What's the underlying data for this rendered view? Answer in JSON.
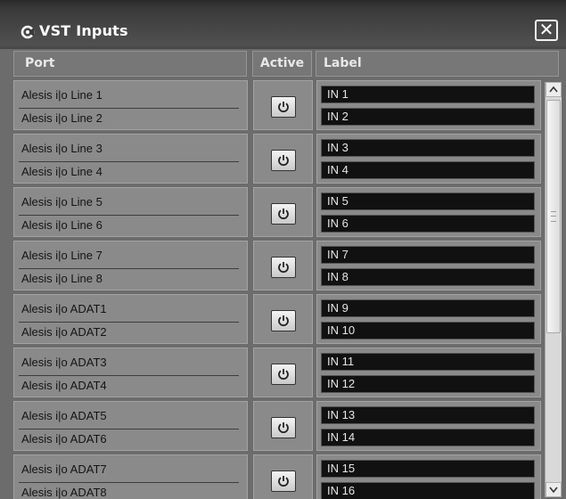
{
  "window": {
    "title": "VST Inputs",
    "close_glyph": "✕",
    "icon": "power-cycle-icon"
  },
  "columns": {
    "port": "Port",
    "active": "Active",
    "label": "Label"
  },
  "rows": [
    {
      "ports": [
        "Alesis i|o Line 1",
        "Alesis i|o Line 2"
      ],
      "labels": [
        "IN 1",
        "IN 2"
      ]
    },
    {
      "ports": [
        "Alesis i|o Line 3",
        "Alesis i|o Line 4"
      ],
      "labels": [
        "IN 3",
        "IN 4"
      ]
    },
    {
      "ports": [
        "Alesis i|o Line 5",
        "Alesis i|o Line 6"
      ],
      "labels": [
        "IN 5",
        "IN 6"
      ]
    },
    {
      "ports": [
        "Alesis i|o Line 7",
        "Alesis i|o Line 8"
      ],
      "labels": [
        "IN 7",
        "IN 8"
      ]
    },
    {
      "ports": [
        "Alesis i|o ADAT1",
        "Alesis i|o ADAT2"
      ],
      "labels": [
        "IN 9",
        "IN 10"
      ]
    },
    {
      "ports": [
        "Alesis i|o ADAT3",
        "Alesis i|o ADAT4"
      ],
      "labels": [
        "IN 11",
        "IN 12"
      ]
    },
    {
      "ports": [
        "Alesis i|o ADAT5",
        "Alesis i|o ADAT6"
      ],
      "labels": [
        "IN 13",
        "IN 14"
      ]
    },
    {
      "ports": [
        "Alesis i|o ADAT7",
        "Alesis i|o ADAT8"
      ],
      "labels": [
        "IN 15",
        "IN 16"
      ]
    }
  ],
  "scrollbar": {
    "up_icon": "scroll-up-arrow-icon",
    "down_icon": "scroll-down-arrow-icon",
    "thumb_position": 0
  }
}
